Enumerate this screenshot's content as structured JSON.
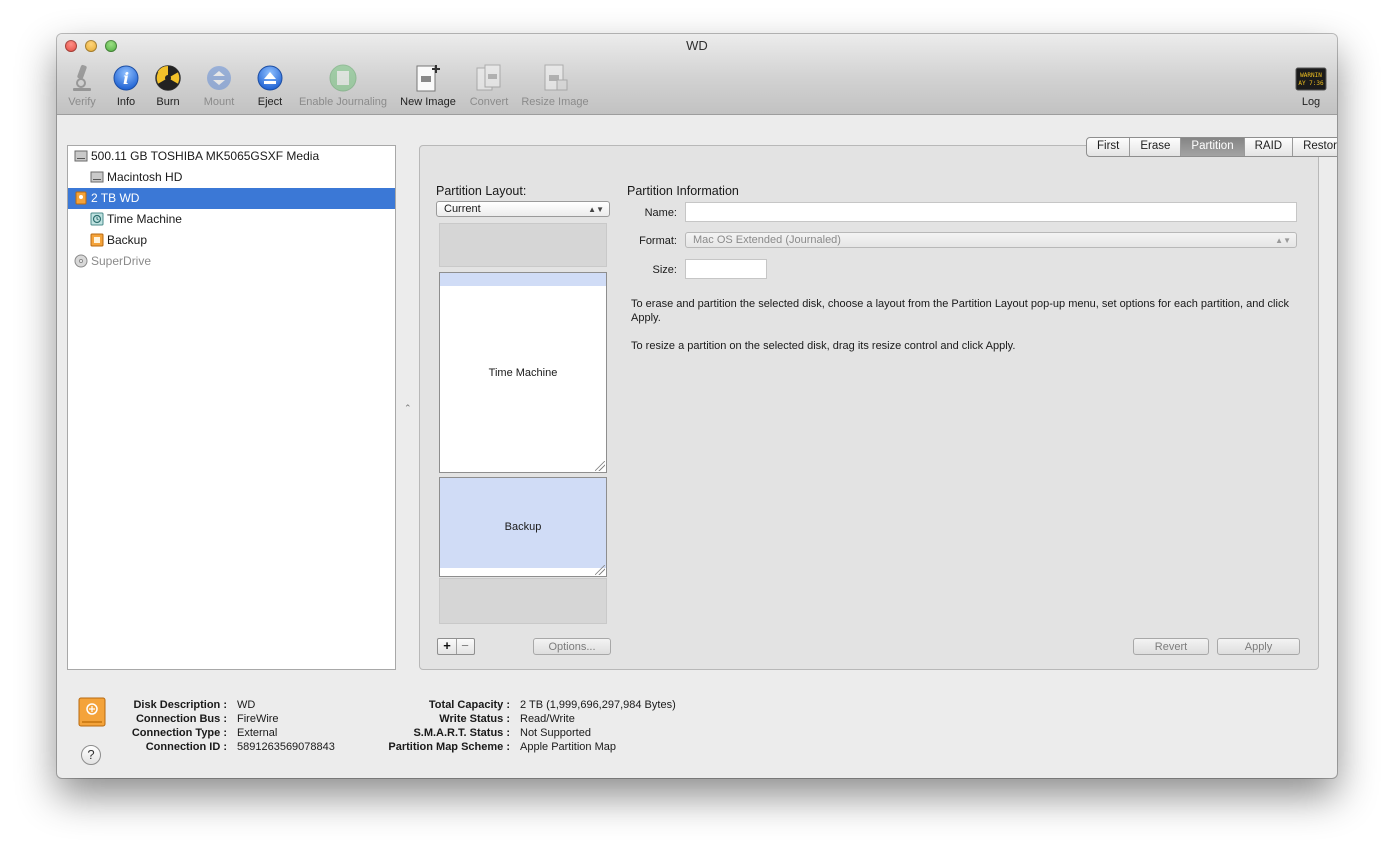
{
  "window": {
    "title": "WD"
  },
  "toolbar": {
    "items": [
      {
        "label": "Verify",
        "icon": "microscope-icon",
        "enabled": false
      },
      {
        "label": "Info",
        "icon": "info-icon",
        "enabled": true
      },
      {
        "label": "Burn",
        "icon": "burn-icon",
        "enabled": true
      },
      {
        "label": "Mount",
        "icon": "mount-icon",
        "enabled": false
      },
      {
        "label": "Eject",
        "icon": "eject-icon",
        "enabled": true
      },
      {
        "label": "Enable Journaling",
        "icon": "journal-icon",
        "enabled": false
      },
      {
        "label": "New Image",
        "icon": "new-image-icon",
        "enabled": true
      },
      {
        "label": "Convert",
        "icon": "convert-icon",
        "enabled": false
      },
      {
        "label": "Resize Image",
        "icon": "resize-image-icon",
        "enabled": false
      }
    ],
    "log": {
      "label": "Log",
      "icon_text_1": "WARNIN",
      "icon_text_2": "AY 7:36"
    }
  },
  "sidebar": {
    "items": [
      {
        "label": "500.11 GB TOSHIBA MK5065GSXF Media",
        "level": 0,
        "icon": "internal-disk-icon",
        "selected": false,
        "dim": false
      },
      {
        "label": "Macintosh HD",
        "level": 1,
        "icon": "volume-icon",
        "selected": false,
        "dim": false
      },
      {
        "label": "2 TB WD",
        "level": 0,
        "icon": "external-disk-icon",
        "selected": true,
        "dim": false
      },
      {
        "label": "Time Machine",
        "level": 1,
        "icon": "time-machine-volume-icon",
        "selected": false,
        "dim": false
      },
      {
        "label": "Backup",
        "level": 1,
        "icon": "external-volume-icon",
        "selected": false,
        "dim": false
      },
      {
        "label": "SuperDrive",
        "level": 0,
        "icon": "optical-drive-icon",
        "selected": false,
        "dim": true
      }
    ]
  },
  "tabs": [
    {
      "label": "First Aid",
      "active": false
    },
    {
      "label": "Erase",
      "active": false
    },
    {
      "label": "Partition",
      "active": true
    },
    {
      "label": "RAID",
      "active": false
    },
    {
      "label": "Restore",
      "active": false
    }
  ],
  "partition": {
    "layout_label": "Partition Layout:",
    "layout_value": "Current",
    "partitions": [
      {
        "name": "Time Machine"
      },
      {
        "name": "Backup"
      }
    ],
    "plus": "+",
    "minus": "−",
    "options_button": "Options...",
    "info_title": "Partition Information",
    "name_label": "Name:",
    "name_value": "",
    "format_label": "Format:",
    "format_value": "Mac OS Extended (Journaled)",
    "size_label": "Size:",
    "size_value": "",
    "info_text_1": "To erase and partition the selected disk, choose a layout from the Partition Layout pop-up menu, set options for each partition, and click Apply.",
    "info_text_2": "To resize a partition on the selected disk, drag its resize control and click Apply.",
    "revert_button": "Revert",
    "apply_button": "Apply"
  },
  "details": {
    "disk_description_label": "Disk Description :",
    "disk_description": "WD",
    "connection_bus_label": "Connection Bus :",
    "connection_bus": "FireWire",
    "connection_type_label": "Connection Type :",
    "connection_type": "External",
    "connection_id_label": "Connection ID :",
    "connection_id": "5891263569078843",
    "total_capacity_label": "Total Capacity :",
    "total_capacity": "2 TB (1,999,696,297,984 Bytes)",
    "write_status_label": "Write Status :",
    "write_status": "Read/Write",
    "smart_status_label": "S.M.A.R.T. Status :",
    "smart_status": "Not Supported",
    "partition_map_label": "Partition Map Scheme :",
    "partition_map": "Apple Partition Map",
    "help": "?"
  },
  "colors": {
    "selection": "#3b78d6",
    "panel": "#e3e3e3",
    "partition_selected": "#d0dcf6"
  }
}
